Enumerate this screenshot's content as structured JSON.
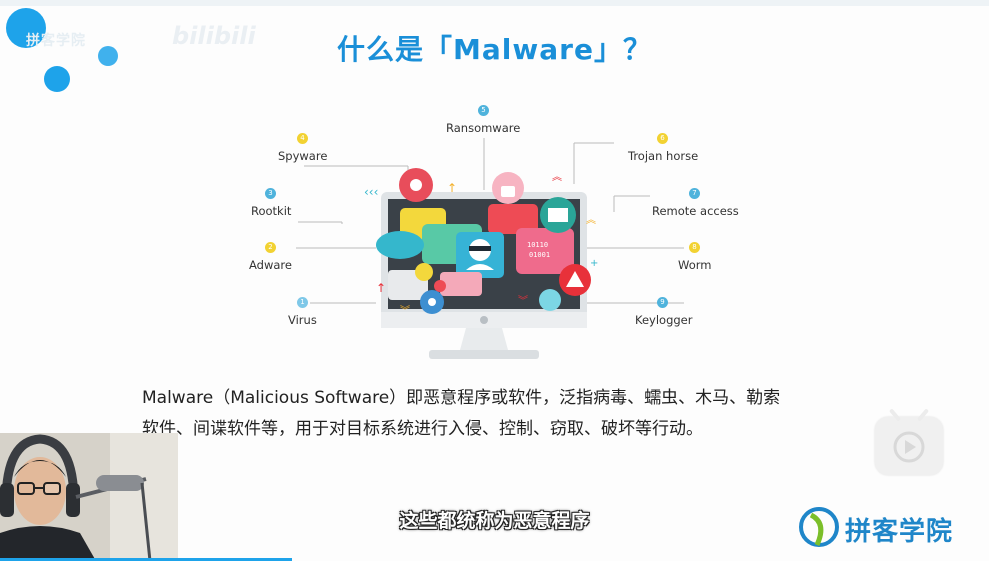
{
  "slide": {
    "watermark_text": "拼客学院",
    "bili_logo_text": "bilibili",
    "title": "什么是「Malware」？",
    "description_line1": "Malware（Malicious Software）即恶意程序或软件，泛指病毒、蠕虫、木马、勒索",
    "description_line2": "软件、间谍软件等，用于对目标系统进行入侵、控制、窃取、破坏等行动。",
    "subtitle": "这些都统称为恶意程序"
  },
  "diagram": {
    "items": [
      {
        "num": "1",
        "label": "Virus",
        "color": "#7fc8e8"
      },
      {
        "num": "2",
        "label": "Adware",
        "color": "#f2d232"
      },
      {
        "num": "3",
        "label": "Rootkit",
        "color": "#4fb3dc"
      },
      {
        "num": "4",
        "label": "Spyware",
        "color": "#f2d232"
      },
      {
        "num": "5",
        "label": "Ransomware",
        "color": "#4fb3dc"
      },
      {
        "num": "6",
        "label": "Trojan horse",
        "color": "#f2d232"
      },
      {
        "num": "7",
        "label": "Remote access",
        "color": "#4fb3dc"
      },
      {
        "num": "8",
        "label": "Worm",
        "color": "#f2d232"
      },
      {
        "num": "9",
        "label": "Keylogger",
        "color": "#4fb3dc"
      }
    ],
    "screen_code_text": [
      "10110",
      "01001"
    ]
  },
  "brand": {
    "name": "拼客学院",
    "color": "#1f86c9",
    "accent": "#7bbf2a"
  },
  "colors": {
    "title": "#1a8fd8",
    "bubble": "#1ea3ea"
  }
}
